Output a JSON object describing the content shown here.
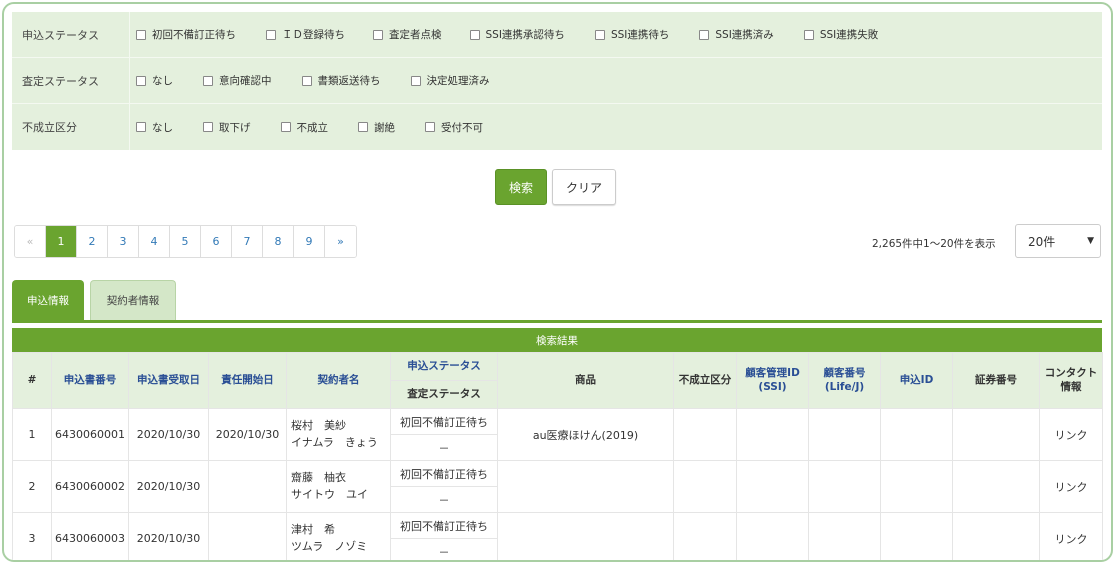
{
  "filters": [
    {
      "label": "申込ステータス",
      "options": [
        "初回不備訂正待ち",
        "ＩＤ登録待ち",
        "査定者点検",
        "SSI連携承認待ち",
        "SSI連携待ち",
        "SSI連携済み",
        "SSI連携失敗"
      ]
    },
    {
      "label": "査定ステータス",
      "options": [
        "なし",
        "意向確認中",
        "書類返送待ち",
        "決定処理済み"
      ]
    },
    {
      "label": "不成立区分",
      "options": [
        "なし",
        "取下げ",
        "不成立",
        "謝絶",
        "受付不可"
      ]
    }
  ],
  "buttons": {
    "search": "検索",
    "clear": "クリア"
  },
  "pagination": {
    "prev": "«",
    "pages": [
      "1",
      "2",
      "3",
      "4",
      "5",
      "6",
      "7",
      "8",
      "9"
    ],
    "next": "»",
    "active": "1"
  },
  "result_count": "2,265件中1～20件を表示",
  "page_size": "20件",
  "tabs": {
    "apply": "申込情報",
    "contract": "契約者情報"
  },
  "results_title": "検索結果",
  "columns": {
    "num": "#",
    "app_no": "申込書番号",
    "received": "申込書受取日",
    "start": "責任開始日",
    "name": "契約者名",
    "app_status": "申込ステータス",
    "assess_status": "査定ステータス",
    "product": "商品",
    "failure": "不成立区分",
    "cust_id_1": "顧客管理ID",
    "cust_id_2": "(SSI)",
    "cust_no_1": "顧客番号",
    "cust_no_2": "(Life/J)",
    "app_id": "申込ID",
    "cert_no": "証券番号",
    "contact_1": "コンタクト",
    "contact_2": "情報"
  },
  "rows": [
    {
      "num": "1",
      "app_no": "6430060001",
      "received": "2020/10/30",
      "start": "2020/10/30",
      "name_kanji": "桜村　美紗",
      "name_kana": "イナムラ　きょう",
      "app_status": "初回不備訂正待ち",
      "assess_status": "－",
      "product": "au医療ほけん(2019)",
      "contact": "リンク"
    },
    {
      "num": "2",
      "app_no": "6430060002",
      "received": "2020/10/30",
      "start": "",
      "name_kanji": "齋藤　柚衣",
      "name_kana": "サイトウ　ユイ",
      "app_status": "初回不備訂正待ち",
      "assess_status": "－",
      "product": "",
      "contact": "リンク"
    },
    {
      "num": "3",
      "app_no": "6430060003",
      "received": "2020/10/30",
      "start": "",
      "name_kanji": "津村　希",
      "name_kana": "ツムラ　ノゾミ",
      "app_status": "初回不備訂正待ち",
      "assess_status": "－",
      "product": "",
      "contact": "リンク"
    }
  ]
}
